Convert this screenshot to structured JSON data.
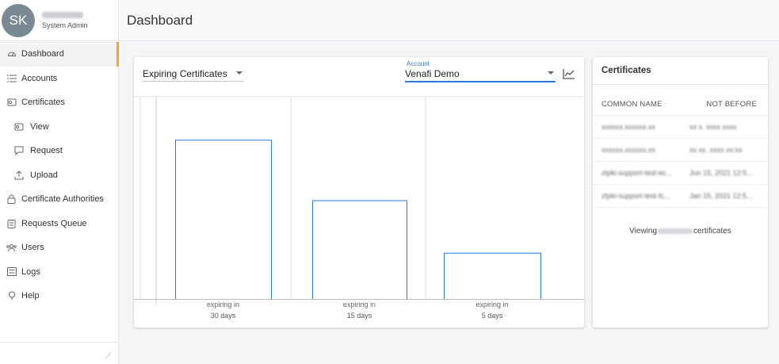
{
  "profile": {
    "initials": "SK",
    "role": "System Admin"
  },
  "nav": [
    {
      "label": "Dashboard",
      "icon": "dashboard-icon"
    },
    {
      "label": "Accounts",
      "icon": "list-icon"
    },
    {
      "label": "Certificates",
      "icon": "certificate-icon"
    },
    {
      "label": "View",
      "icon": "view-icon"
    },
    {
      "label": "Request",
      "icon": "request-icon"
    },
    {
      "label": "Upload",
      "icon": "upload-icon"
    },
    {
      "label": "Certificate Authorities",
      "icon": "lock-icon"
    },
    {
      "label": "Requests Queue",
      "icon": "clipboard-icon"
    },
    {
      "label": "Users",
      "icon": "users-icon"
    },
    {
      "label": "Logs",
      "icon": "logs-icon"
    },
    {
      "label": "Help",
      "icon": "help-icon"
    }
  ],
  "header": {
    "title": "Dashboard"
  },
  "chart_panel": {
    "selector_value": "Expiring Certificates",
    "account_label": "Account",
    "account_value": "Venafi Demo"
  },
  "chart_data": {
    "type": "bar",
    "categories": [
      "expiring in 30 days",
      "expiring in 15 days",
      "expiring in 5 days"
    ],
    "tick_lines": [
      [
        "expiring in",
        "30 days"
      ],
      [
        "expiring in",
        "15 days"
      ],
      [
        "expiring in",
        "5 days"
      ]
    ],
    "values": [
      10,
      6.2,
      2.9
    ],
    "ylim": [
      0,
      12.8
    ],
    "grid": true,
    "colors": {
      "bar_stroke": "#2b78e4",
      "grid": "#e2e2e2"
    }
  },
  "certificates": {
    "title": "Certificates",
    "columns": [
      "COMMON NAME",
      "NOT BEFORE"
    ],
    "rows": [
      {
        "common_name": "xxxxxx.xxxxxx.xx",
        "not_before": "xx x. xxxx xxxx"
      },
      {
        "common_name": "xxxxxx.xxxxxx.xx",
        "not_before": "xx xx. xxxx xx:xx"
      },
      {
        "common_name": "ztpki-support-test-ec...",
        "not_before": "Jun 15, 2021 12:5..."
      },
      {
        "common_name": "ztpki-support-test-fc...",
        "not_before": "Jan 15, 2021 12:5..."
      }
    ],
    "viewing_prefix": "Viewing",
    "viewing_suffix": "certificates"
  },
  "colors": {
    "accent": "#f5a623",
    "primary": "#2b78e4",
    "avatar": "#7a8a92"
  }
}
